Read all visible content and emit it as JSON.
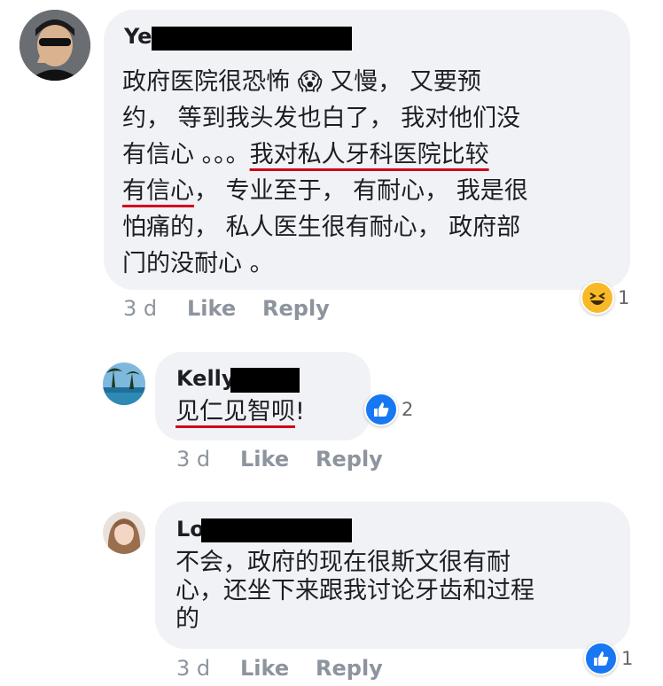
{
  "comments": [
    {
      "name": "Ye",
      "text_lines": [
        "政府医院很恐怖 😱 又慢， 又要预",
        "约， 等到我头发也白了， 我对他们没",
        "有信心 。。。",
        "我对私人牙科医院比较",
        "有信心",
        "， 专业至于， 有耐心， 我是很",
        "怕痛的， 私人医生很有耐心， 政府部",
        "门的没耐心 。"
      ],
      "time": "3 d",
      "like_label": "Like",
      "reply_label": "Reply",
      "reaction": {
        "icon": "laugh-emoji-icon",
        "count": "1"
      }
    },
    {
      "name": "Kelly",
      "text": "见仁见智呗",
      "text_end": "!",
      "time": "3 d",
      "like_label": "Like",
      "reply_label": "Reply",
      "reaction": {
        "icon": "thumbs-up-icon",
        "count": "2"
      }
    },
    {
      "name": "Lo",
      "text_lines": [
        "不会，政府的现在很斯文很有耐",
        "心，还坐下来跟我讨论牙齿和过程",
        "的"
      ],
      "time": "3 d",
      "like_label": "Like",
      "reply_label": "Reply",
      "reaction": {
        "icon": "thumbs-up-icon",
        "count": "1"
      }
    }
  ],
  "colors": {
    "bubble": "#f0f2f5",
    "underline": "#d0021b",
    "like_blue": "#1877f2",
    "emoji_yellow": "#f7b928"
  }
}
